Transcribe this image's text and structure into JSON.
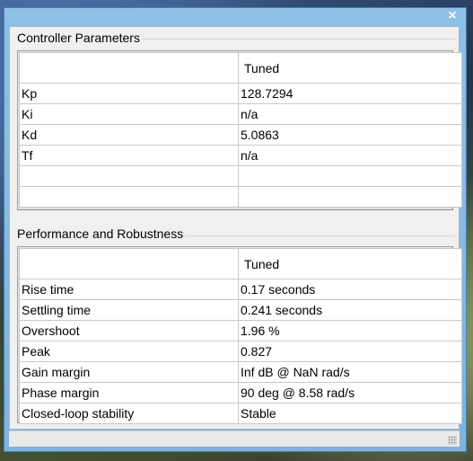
{
  "window": {
    "close_icon": "×"
  },
  "controller": {
    "title": "Controller Parameters",
    "header": [
      "",
      "Tuned"
    ],
    "rows": [
      {
        "name": "Kp",
        "value": "128.7294"
      },
      {
        "name": "Ki",
        "value": "n/a"
      },
      {
        "name": "Kd",
        "value": "5.0863"
      },
      {
        "name": "Tf",
        "value": "n/a"
      },
      {
        "name": "",
        "value": ""
      },
      {
        "name": "",
        "value": ""
      }
    ]
  },
  "performance": {
    "title": "Performance and Robustness",
    "header": [
      "",
      "Tuned"
    ],
    "rows": [
      {
        "name": "Rise time",
        "value": "0.17 seconds"
      },
      {
        "name": "Settling time",
        "value": "0.241 seconds"
      },
      {
        "name": "Overshoot",
        "value": "1.96 %"
      },
      {
        "name": "Peak",
        "value": "0.827"
      },
      {
        "name": "Gain margin",
        "value": "Inf dB @ NaN rad/s"
      },
      {
        "name": "Phase margin",
        "value": "90 deg @ 8.58 rad/s"
      },
      {
        "name": "Closed-loop stability",
        "value": "Stable"
      }
    ]
  }
}
